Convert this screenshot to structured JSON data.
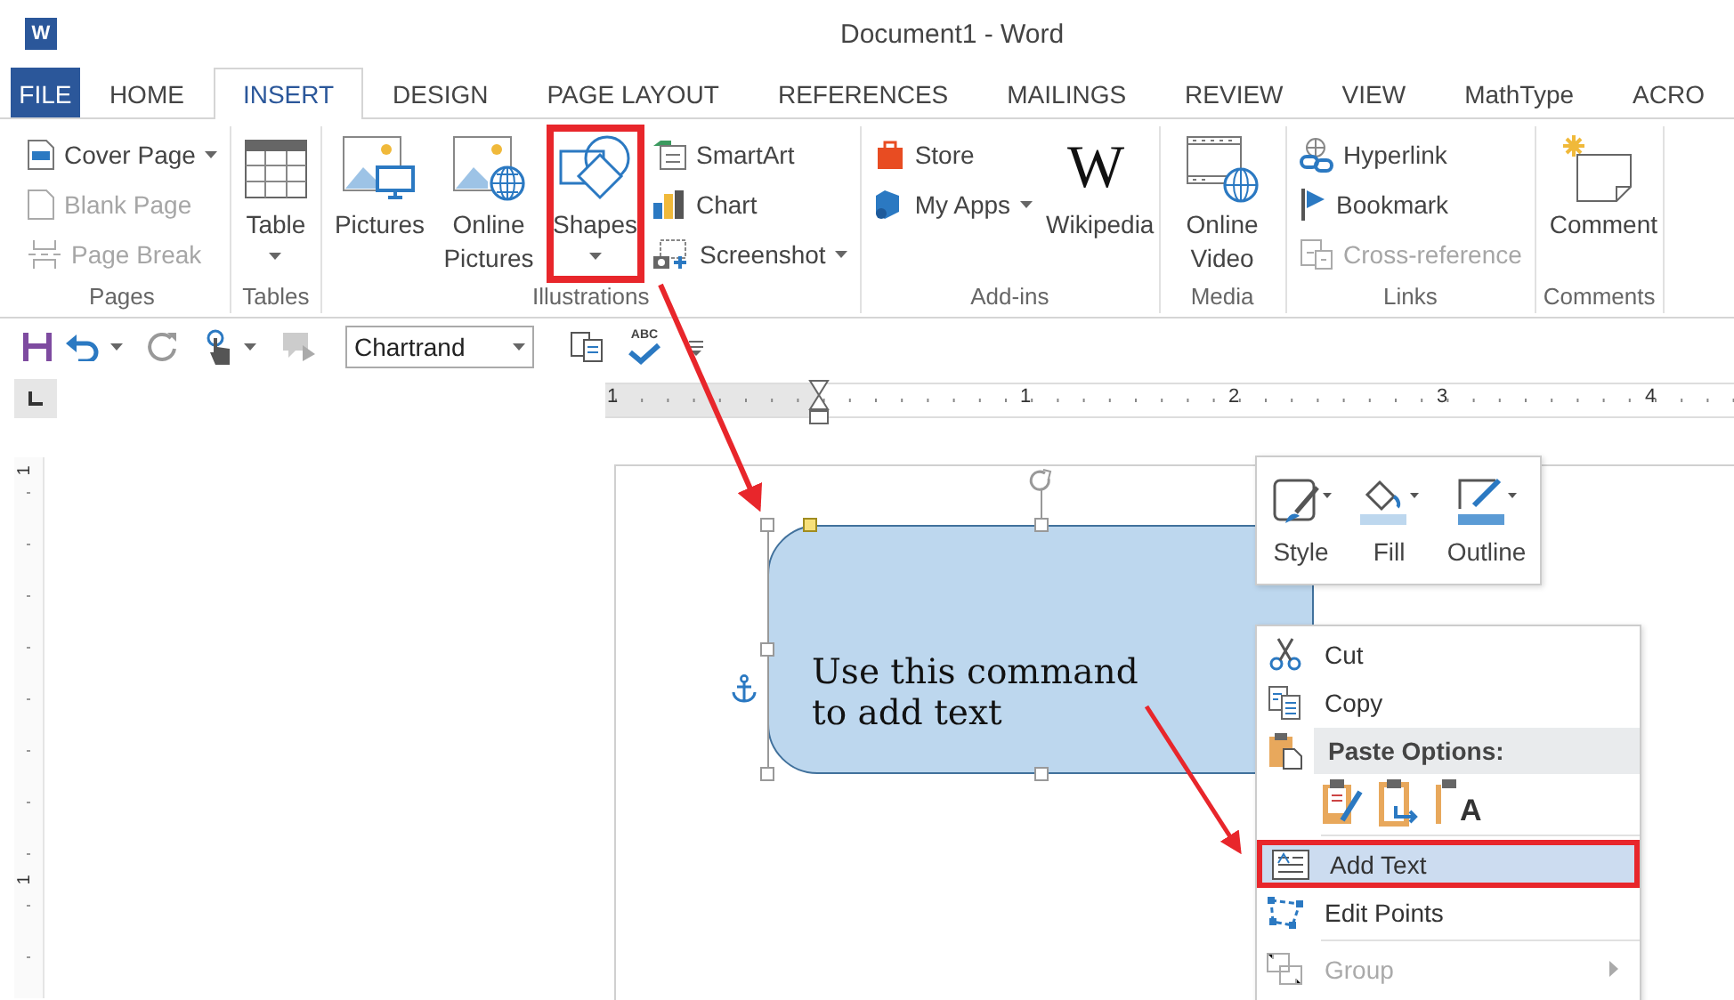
{
  "window": {
    "title": "Document1 - Word",
    "app_icon_glyph": "W"
  },
  "tabs": [
    {
      "label": "FILE",
      "kind": "file",
      "selected": false
    },
    {
      "label": "HOME",
      "kind": "tab",
      "selected": false
    },
    {
      "label": "INSERT",
      "kind": "tab",
      "selected": true
    },
    {
      "label": "DESIGN",
      "kind": "tab",
      "selected": false
    },
    {
      "label": "PAGE LAYOUT",
      "kind": "tab",
      "selected": false
    },
    {
      "label": "REFERENCES",
      "kind": "tab",
      "selected": false
    },
    {
      "label": "MAILINGS",
      "kind": "tab",
      "selected": false
    },
    {
      "label": "REVIEW",
      "kind": "tab",
      "selected": false
    },
    {
      "label": "VIEW",
      "kind": "tab",
      "selected": false
    },
    {
      "label": "MathType",
      "kind": "tab",
      "selected": false
    },
    {
      "label": "ACRO",
      "kind": "tab",
      "selected": false
    }
  ],
  "ribbon": {
    "groups": [
      {
        "label": "Pages",
        "columns": [
          {
            "kind": "stack",
            "items": [
              {
                "label": "Cover Page",
                "disabled": false,
                "dropdown": true,
                "highlighted": false
              },
              {
                "label": "Blank Page",
                "disabled": true,
                "dropdown": false,
                "highlighted": false
              },
              {
                "label": "Page Break",
                "disabled": true,
                "dropdown": false,
                "highlighted": false
              }
            ]
          }
        ]
      },
      {
        "label": "Tables",
        "columns": [
          {
            "kind": "large",
            "label": "Table",
            "disabled": false,
            "dropdown": true,
            "highlighted": false
          }
        ]
      },
      {
        "label": "Illustrations",
        "columns": [
          {
            "kind": "large",
            "label": "Pictures",
            "disabled": false,
            "dropdown": false,
            "highlighted": false
          },
          {
            "kind": "large",
            "label": "Online Pictures",
            "disabled": false,
            "dropdown": false,
            "highlighted": false
          },
          {
            "kind": "large",
            "label": "Shapes",
            "disabled": false,
            "dropdown": true,
            "highlighted": true
          },
          {
            "kind": "stack",
            "items": [
              {
                "label": "SmartArt",
                "disabled": false,
                "dropdown": false,
                "highlighted": false
              },
              {
                "label": "Chart",
                "disabled": false,
                "dropdown": false,
                "highlighted": false
              },
              {
                "label": "Screenshot",
                "disabled": false,
                "dropdown": true,
                "highlighted": false
              }
            ]
          }
        ]
      },
      {
        "label": "Add-ins",
        "columns": [
          {
            "kind": "stack",
            "items": [
              {
                "label": "Store",
                "disabled": false,
                "dropdown": false,
                "highlighted": false
              },
              {
                "label": "My Apps",
                "disabled": false,
                "dropdown": true,
                "highlighted": false
              }
            ]
          },
          {
            "kind": "large",
            "label": "Wikipedia",
            "glyph": "W",
            "disabled": false,
            "dropdown": false,
            "highlighted": false
          }
        ]
      },
      {
        "label": "Media",
        "columns": [
          {
            "kind": "large",
            "label": "Online Video",
            "disabled": false,
            "dropdown": false,
            "highlighted": false
          }
        ]
      },
      {
        "label": "Links",
        "columns": [
          {
            "kind": "stack",
            "items": [
              {
                "label": "Hyperlink",
                "disabled": false,
                "dropdown": false,
                "highlighted": false
              },
              {
                "label": "Bookmark",
                "disabled": false,
                "dropdown": false,
                "highlighted": false
              },
              {
                "label": "Cross-reference",
                "disabled": true,
                "dropdown": false,
                "highlighted": false
              }
            ]
          }
        ]
      },
      {
        "label": "Comments",
        "columns": [
          {
            "kind": "large",
            "label": "Comment",
            "disabled": false,
            "dropdown": false,
            "highlighted": false
          }
        ]
      }
    ]
  },
  "quick_access": {
    "font_field": {
      "value": "Chartrand"
    },
    "spelling_label": "ABC"
  },
  "ruler": {
    "labels": [
      "1",
      "1",
      "2",
      "3",
      "4"
    ]
  },
  "vertical_ruler": {
    "labels": [
      "1",
      "1"
    ]
  },
  "document": {
    "shape": {
      "text": "Use this command to add text",
      "selected": true
    }
  },
  "mini_toolbar": {
    "buttons": [
      {
        "label": "Style"
      },
      {
        "label": "Fill"
      },
      {
        "label": "Outline"
      }
    ]
  },
  "context_menu": {
    "items": [
      {
        "kind": "item",
        "label": "Cut",
        "disabled": false,
        "highlighted": false,
        "submenu": false
      },
      {
        "kind": "item",
        "label": "Copy",
        "disabled": false,
        "highlighted": false,
        "submenu": false
      },
      {
        "kind": "header",
        "label": "Paste Options:"
      },
      {
        "kind": "paste_buttons",
        "text_only_glyph": "A"
      },
      {
        "kind": "separator"
      },
      {
        "kind": "item",
        "label": "Add Text",
        "disabled": false,
        "highlighted": true,
        "submenu": false
      },
      {
        "kind": "item",
        "label": "Edit Points",
        "disabled": false,
        "highlighted": false,
        "submenu": false
      },
      {
        "kind": "separator"
      },
      {
        "kind": "item",
        "label": "Group",
        "disabled": true,
        "highlighted": false,
        "submenu": true
      }
    ]
  }
}
